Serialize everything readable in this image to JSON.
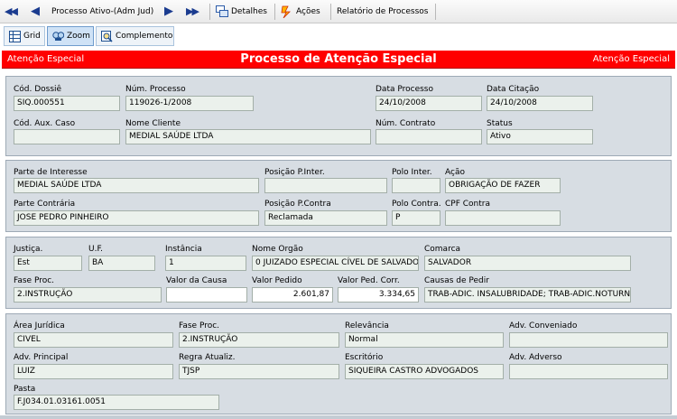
{
  "toolbar": {
    "process_label": "Processo Ativo-(Adm Jud)",
    "detalhes": "Detalhes",
    "acoes": "Ações",
    "relatorio": "Relatório de Processos"
  },
  "tabs": [
    {
      "label": "Grid"
    },
    {
      "label": "Zoom"
    },
    {
      "label": "Complemento"
    }
  ],
  "banner": {
    "left": "Atenção Especial",
    "title": "Processo de Atenção Especial",
    "right": "Atenção Especial"
  },
  "p1": {
    "cod_dossie": {
      "label": "Cód. Dossiê",
      "value": "SIQ.000551"
    },
    "num_processo": {
      "label": "Núm. Processo",
      "value": "119026-1/2008"
    },
    "data_processo": {
      "label": "Data Processo",
      "value": "24/10/2008"
    },
    "data_citacao": {
      "label": "Data Citação",
      "value": "24/10/2008"
    },
    "cod_aux": {
      "label": "Cód. Aux. Caso",
      "value": ""
    },
    "nome_cliente": {
      "label": "Nome Cliente",
      "value": "MEDIAL SAÚDE LTDA"
    },
    "num_contrato": {
      "label": "Núm. Contrato",
      "value": ""
    },
    "status": {
      "label": "Status",
      "value": "Ativo"
    }
  },
  "p2": {
    "parte_interesse": {
      "label": "Parte de Interesse",
      "value": "MEDIAL SAÚDE LTDA"
    },
    "pos_inter": {
      "label": "Posição P.Inter.",
      "value": ""
    },
    "polo_inter": {
      "label": "Polo Inter.",
      "value": ""
    },
    "acao": {
      "label": "Ação",
      "value": "OBRIGAÇÃO DE FAZER"
    },
    "parte_contraria": {
      "label": "Parte Contrária",
      "value": "JOSE PEDRO PINHEIRO"
    },
    "pos_contra": {
      "label": "Posição P.Contra",
      "value": "Reclamada"
    },
    "polo_contra": {
      "label": "Polo Contra.",
      "value": "P"
    },
    "cpf_contra": {
      "label": "CPF Contra",
      "value": ""
    }
  },
  "p3": {
    "justica": {
      "label": "Justiça.",
      "value": "Est"
    },
    "uf": {
      "label": "U.F.",
      "value": "BA"
    },
    "instancia": {
      "label": "Instância",
      "value": "1"
    },
    "nome_orgao": {
      "label": "Nome Orgão",
      "value": "0 JUIZADO ESPECIAL CÍVEL DE SALVADO"
    },
    "comarca": {
      "label": "Comarca",
      "value": "SALVADOR"
    },
    "fase_proc": {
      "label": "Fase Proc.",
      "value": "2.INSTRUÇÃO"
    },
    "valor_causa": {
      "label": "Valor da Causa",
      "value": ""
    },
    "valor_pedido": {
      "label": "Valor Pedido",
      "value": "2.601,87"
    },
    "valor_ped_corr": {
      "label": "Valor Ped. Corr.",
      "value": "3.334,65"
    },
    "causas_pedir": {
      "label": "Causas de Pedir",
      "value": "TRAB-ADIC. INSALUBRIDADE; TRAB-ADIC.NOTURNO"
    }
  },
  "p4": {
    "area_juridica": {
      "label": "Área Jurídica",
      "value": "CIVEL"
    },
    "fase_proc": {
      "label": "Fase Proc.",
      "value": "2.INSTRUÇÃO"
    },
    "relevancia": {
      "label": "Relevância",
      "value": "Normal"
    },
    "adv_conveniado": {
      "label": "Adv. Conveniado",
      "value": ""
    },
    "adv_principal": {
      "label": "Adv. Principal",
      "value": "LUIZ"
    },
    "regra_atualiz": {
      "label": "Regra Atualiz.",
      "value": "TJSP"
    },
    "escritorio": {
      "label": "Escritório",
      "value": "SIQUEIRA CASTRO ADVOGADOS"
    },
    "adv_adverso": {
      "label": "Adv. Adverso",
      "value": ""
    },
    "pasta": {
      "label": "Pasta",
      "value": "F.J034.01.03161.0051"
    }
  }
}
